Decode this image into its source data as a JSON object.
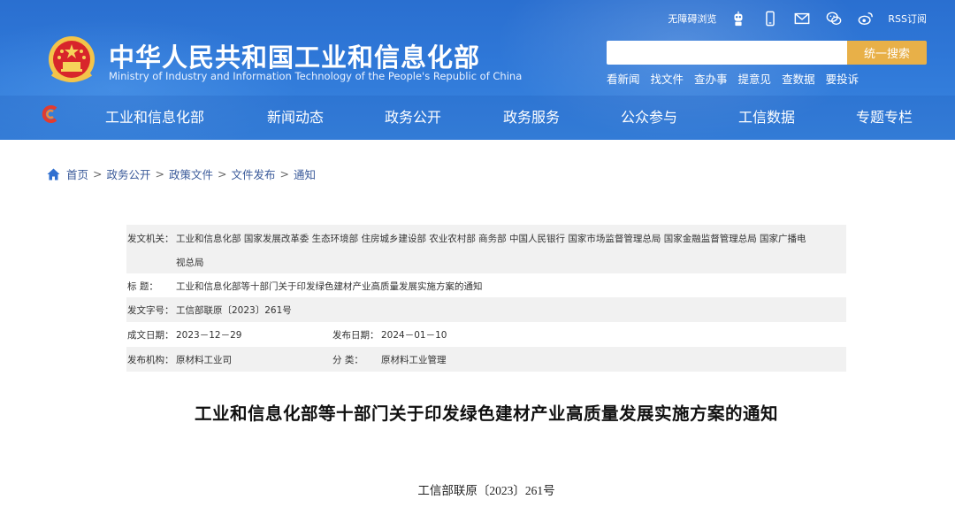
{
  "header": {
    "title_cn": "中华人民共和国工业和信息化部",
    "title_en": "Ministry of Industry and Information Technology of the People's Republic of China",
    "top_links": {
      "accessibility": "无障碍浏览",
      "rss": "RSS订阅"
    },
    "icons": [
      "robot-assistant-icon",
      "mobile-icon",
      "mail-icon",
      "wechat-icon",
      "weibo-icon"
    ],
    "search": {
      "placeholder": "",
      "button": "统一搜索"
    },
    "quick_links": [
      "看新闻",
      "找文件",
      "查办事",
      "提意见",
      "查数据",
      "要投诉"
    ],
    "nav": [
      "工业和信息化部",
      "新闻动态",
      "政务公开",
      "政务服务",
      "公众参与",
      "工信数据",
      "专题专栏"
    ]
  },
  "breadcrumb": [
    "首页",
    "政务公开",
    "政策文件",
    "文件发布",
    "通知"
  ],
  "meta": {
    "issuer_label": "发文机关：",
    "issuer_line1": "工业和信息化部  国家发展改革委  生态环境部  住房城乡建设部  农业农村部  商务部  中国人民银行  国家市场监督管理总局  国家金融监督管理总局  国家广播电",
    "issuer_line2": "视总局",
    "title_label": "标       题：",
    "title_value": "工业和信息化部等十部门关于印发绿色建材产业高质量发展实施方案的通知",
    "docno_label": "发文字号：",
    "docno_value": "工信部联原〔2023〕261号",
    "date_written_label": "成文日期：",
    "date_written_value": "2023－12－29",
    "date_published_label": "发布日期：",
    "date_published_value": "2024－01－10",
    "org_label": "发布机构：",
    "org_value": "原材料工业司",
    "category_label": "分       类：",
    "category_value": "原材料工业管理"
  },
  "document": {
    "title": "工业和信息化部等十部门关于印发绿色建材产业高质量发展实施方案的通知",
    "number": "工信部联原〔2023〕261号"
  },
  "colors": {
    "header_blue": "#2f78d8",
    "search_button": "#e8b048",
    "breadcrumb_link": "#3a5a9a",
    "meta_row_alt": "#f1f1f1"
  }
}
